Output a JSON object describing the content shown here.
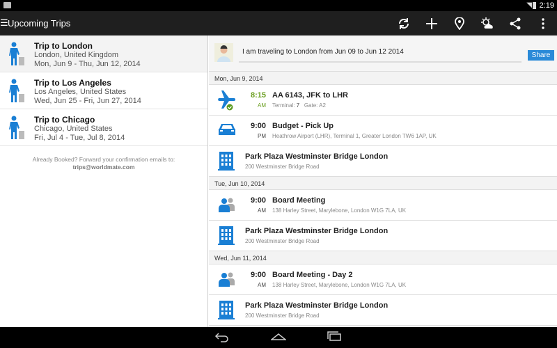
{
  "status": {
    "time": "2:19"
  },
  "actionbar": {
    "title": "Upcoming Trips",
    "actions": [
      "refresh-icon",
      "add-icon",
      "location-icon",
      "weather-icon",
      "share-icon",
      "overflow-icon"
    ]
  },
  "trips": [
    {
      "title": "Trip to London",
      "location": "London, United Kingdom",
      "dates": "Mon, Jun 9 - Thu, Jun 12, 2014"
    },
    {
      "title": "Trip to Los Angeles",
      "location": "Los Angeles, United States",
      "dates": "Wed, Jun 25 - Fri, Jun 27, 2014"
    },
    {
      "title": "Trip to Chicago",
      "location": "Chicago, United States",
      "dates": "Fri, Jul 4 - Tue, Jul 8, 2014"
    }
  ],
  "footer": {
    "text": "Already Booked? Forward your confirmation emails to:",
    "email": "trips@worldmate.com"
  },
  "share": {
    "text": "I am traveling to London from Jun 09 to Jun 12 2014",
    "button": "Share"
  },
  "days": [
    {
      "date": "Mon, Jun 9, 2014",
      "items": [
        {
          "type": "flight",
          "time": "8:15",
          "ampm": "AM",
          "title": "AA 6143, JFK to LHR",
          "terminal_label": "Terminal:",
          "terminal": "7",
          "gate_label": "Gate:",
          "gate": "A2"
        },
        {
          "type": "car",
          "time": "9:00",
          "ampm": "PM",
          "title": "Budget - Pick Up",
          "sub": "Heathrow Airport (LHR), Terminal 1, Greater London TW6 1AP, UK"
        },
        {
          "type": "hotel",
          "title": "Park Plaza Westminster Bridge London",
          "sub": "200 Westminster Bridge Road"
        }
      ]
    },
    {
      "date": "Tue, Jun 10, 2014",
      "items": [
        {
          "type": "meeting",
          "time": "9:00",
          "ampm": "AM",
          "title": "Board Meeting",
          "sub": "138 Harley Street, Marylebone, London W1G 7LA, UK"
        },
        {
          "type": "hotel",
          "title": "Park Plaza Westminster Bridge London",
          "sub": "200 Westminster Bridge Road"
        }
      ]
    },
    {
      "date": "Wed, Jun 11, 2014",
      "items": [
        {
          "type": "meeting",
          "time": "9:00",
          "ampm": "AM",
          "title": "Board Meeting  - Day 2",
          "sub": "138 Harley Street, Marylebone, London W1G 7LA, UK"
        },
        {
          "type": "hotel",
          "title": "Park Plaza Westminster Bridge London",
          "sub": "200 Westminster Bridge Road"
        }
      ]
    }
  ],
  "colors": {
    "accent": "#1a7fd4",
    "green": "#6a9e1f",
    "share": "#2a8ad8"
  }
}
